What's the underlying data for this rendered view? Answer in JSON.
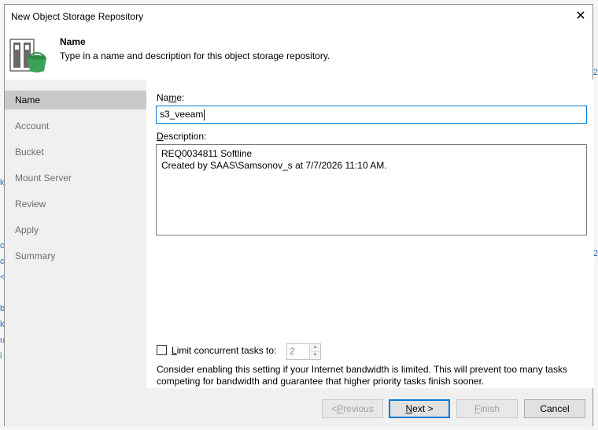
{
  "dialog": {
    "title": "New Object Storage Repository",
    "close_glyph": "✕"
  },
  "header": {
    "icon": "repository-bucket-icon",
    "title": "Name",
    "description": "Type in a name and description for this object storage repository."
  },
  "sidebar": {
    "items": [
      {
        "label": "Name",
        "active": true
      },
      {
        "label": "Account",
        "active": false
      },
      {
        "label": "Bucket",
        "active": false
      },
      {
        "label": "Mount Server",
        "active": false
      },
      {
        "label": "Review",
        "active": false
      },
      {
        "label": "Apply",
        "active": false
      },
      {
        "label": "Summary",
        "active": false
      }
    ]
  },
  "form": {
    "name_label_pre": "Na",
    "name_label_mnemonic": "m",
    "name_label_post": "e:",
    "name_value": "s3_veeam",
    "description_label_mnemonic": "D",
    "description_label_post": "escription:",
    "description_lines": [
      "REQ0034811 Softline",
      "Created by SAAS\\Samsonov_s at 7/7/2026 11:10 AM."
    ],
    "limit_checkbox_checked": false,
    "limit_label_mnemonic": "L",
    "limit_label_post": "imit concurrent tasks to:",
    "limit_value": "2",
    "hint": "Consider enabling this setting if your Internet bandwidth is limited. This will prevent too many tasks competing for bandwidth and guarantee that higher priority tasks finish sooner."
  },
  "footer": {
    "previous_pre": "< ",
    "previous_mnemonic": "P",
    "previous_post": "revious",
    "next_mnemonic": "N",
    "next_post": "ext >",
    "finish_mnemonic": "F",
    "finish_post": "inish",
    "cancel_label": "Cancel"
  },
  "background": {
    "fragments": [
      "k",
      "c",
      "c",
      "<",
      "b",
      "k",
      "u",
      "i",
      "2",
      "2"
    ]
  },
  "colors": {
    "accent": "#0078d7",
    "sidebar_bg": "#f0f0f0",
    "sidebar_active": "#c9c9c9",
    "icon_green": "#3aa357"
  }
}
